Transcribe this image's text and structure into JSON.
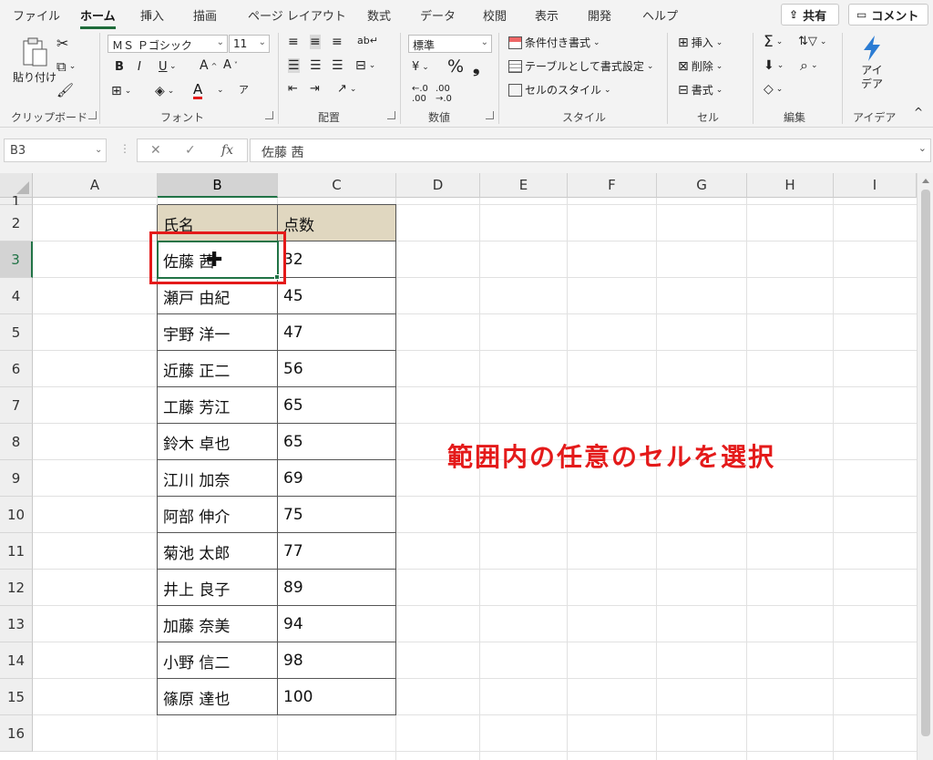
{
  "ribbon_tabs": [
    "ファイル",
    "ホーム",
    "挿入",
    "描画",
    "ページ レイアウト",
    "数式",
    "データ",
    "校閲",
    "表示",
    "開発",
    "ヘルプ"
  ],
  "active_tab": "ホーム",
  "share_label": "共有",
  "comment_label": "コメント",
  "clipboard": {
    "paste": "貼り付け",
    "group": "クリップボード"
  },
  "font": {
    "name": "ＭＳ Ｐゴシック",
    "size": "11",
    "group": "フォント",
    "bold": "B",
    "italic": "I",
    "underline": "U",
    "font_color_letter": "A"
  },
  "alignment": {
    "group": "配置"
  },
  "number": {
    "format": "標準",
    "group": "数値",
    "percent": "%",
    "comma": "❟"
  },
  "styles": {
    "conditional": "条件付き書式",
    "as_table": "テーブルとして書式設定",
    "cell_styles": "セルのスタイル",
    "group": "スタイル"
  },
  "cells": {
    "insert": "挿入",
    "delete": "削除",
    "format": "書式",
    "group": "セル"
  },
  "editing": {
    "group": "編集"
  },
  "ideas": {
    "label": "アイ\nデア",
    "group": "アイデア"
  },
  "namebox": "B3",
  "formula_value": "佐藤 茜",
  "fx_symbol": "fx",
  "columns": [
    "A",
    "B",
    "C",
    "D",
    "E",
    "F",
    "G",
    "H",
    "I"
  ],
  "selected_column": "B",
  "rows": [
    "1",
    "2",
    "3",
    "4",
    "5",
    "6",
    "7",
    "8",
    "9",
    "10",
    "11",
    "12",
    "13",
    "14",
    "15",
    "16"
  ],
  "selected_row": "3",
  "table": {
    "headers": [
      "氏名",
      "点数"
    ],
    "rows": [
      [
        "佐藤 茜",
        "32"
      ],
      [
        "瀬戸 由紀",
        "45"
      ],
      [
        "宇野 洋一",
        "47"
      ],
      [
        "近藤 正二",
        "56"
      ],
      [
        "工藤 芳江",
        "65"
      ],
      [
        "鈴木 卓也",
        "65"
      ],
      [
        "江川 加奈",
        "69"
      ],
      [
        "阿部 伸介",
        "75"
      ],
      [
        "菊池 太郎",
        "77"
      ],
      [
        "井上 良子",
        "89"
      ],
      [
        "加藤 奈美",
        "94"
      ],
      [
        "小野 信二",
        "98"
      ],
      [
        "篠原 達也",
        "100"
      ]
    ]
  },
  "annotation": "範囲内の任意のセルを選択",
  "colors": {
    "accent": "#217346",
    "header_fill": "#e0d7c0",
    "annotation": "#e41a1a"
  }
}
